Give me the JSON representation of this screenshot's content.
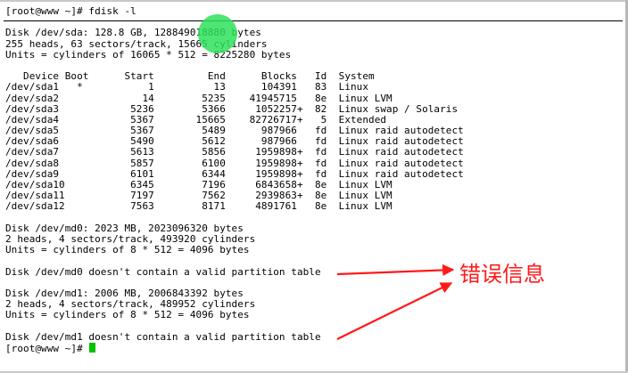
{
  "terminal": {
    "lines": [
      "[root@www ~]# fdisk -l",
      "",
      "Disk /dev/sda: 128.8 GB, 128849018880 bytes",
      "255 heads, 63 sectors/track, 15665 cylinders",
      "Units = cylinders of 16065 * 512 = 8225280 bytes",
      "",
      "   Device Boot      Start         End      Blocks   Id  System",
      "/dev/sda1   *           1          13      104391   83  Linux",
      "/dev/sda2              14        5235    41945715   8e  Linux LVM",
      "/dev/sda3            5236        5366     1052257+  82  Linux swap / Solaris",
      "/dev/sda4            5367       15665    82726717+   5  Extended",
      "/dev/sda5            5367        5489      987966   fd  Linux raid autodetect",
      "/dev/sda6            5490        5612      987966   fd  Linux raid autodetect",
      "/dev/sda7            5613        5856     1959898+  fd  Linux raid autodetect",
      "/dev/sda8            5857        6100     1959898+  fd  Linux raid autodetect",
      "/dev/sda9            6101        6344     1959898+  fd  Linux raid autodetect",
      "/dev/sda10           6345        7196     6843658+  8e  Linux LVM",
      "/dev/sda11           7197        7562     2939863+  8e  Linux LVM",
      "/dev/sda12           7563        8171     4891761   8e  Linux LVM",
      "",
      "Disk /dev/md0: 2023 MB, 2023096320 bytes",
      "2 heads, 4 sectors/track, 493920 cylinders",
      "Units = cylinders of 8 * 512 = 4096 bytes",
      "",
      "Disk /dev/md0 doesn't contain a valid partition table",
      "",
      "Disk /dev/md1: 2006 MB, 2006843392 bytes",
      "2 heads, 4 sectors/track, 489952 cylinders",
      "Units = cylinders of 8 * 512 = 4096 bytes",
      "",
      "Disk /dev/md1 doesn't contain a valid partition table"
    ],
    "prompt": "[root@www ~]# "
  },
  "annotation": {
    "label": "错误信息",
    "color": "#ff1a1a"
  },
  "colors": {
    "background": "#ffffff",
    "text": "#000000",
    "cursor": "#00c000",
    "touch_dot": "#2ee05a"
  }
}
